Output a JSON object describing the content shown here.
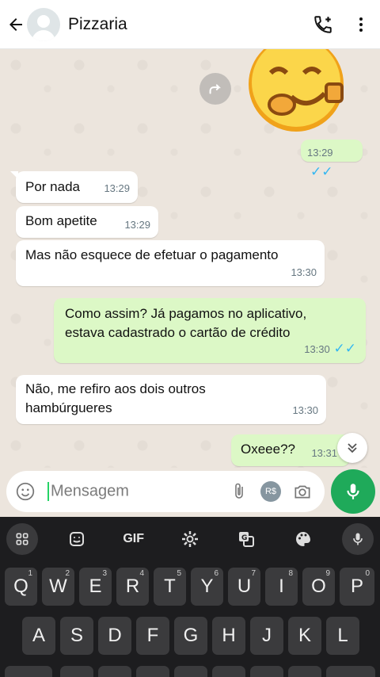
{
  "header": {
    "contact_name": "Pizzaria",
    "icons": [
      "back-arrow-icon",
      "avatar",
      "add-call-icon",
      "more-vert-icon"
    ]
  },
  "messages": [
    {
      "dir": "out",
      "type": "sticker",
      "time": "13:29",
      "status": "read"
    },
    {
      "dir": "in",
      "text": "Por nada",
      "time": "13:29"
    },
    {
      "dir": "in",
      "text": "Bom apetite",
      "time": "13:29"
    },
    {
      "dir": "in",
      "text": "Mas não esquece de efetuar o pagamento",
      "time": "13:30"
    },
    {
      "dir": "out",
      "text": "Como assim? Já pagamos no aplicativo,",
      "text2": "estava cadastrado o cartão de crédito",
      "time": "13:30",
      "status": "read"
    },
    {
      "dir": "in",
      "text": "Não, me refiro aos dois outros",
      "text2": "hambúrgueres",
      "time": "13:30"
    },
    {
      "dir": "out",
      "text": "Oxeee??",
      "time": "13:31",
      "status": "read"
    }
  ],
  "composer": {
    "placeholder": "Mensagem",
    "currency_badge": "R$"
  },
  "keyboard": {
    "toolbar": [
      "apps-grid-icon",
      "sticker-icon",
      "GIF",
      "settings-icon",
      "translate-icon",
      "palette-icon",
      "mic-icon"
    ],
    "row1": [
      {
        "k": "Q",
        "n": "1"
      },
      {
        "k": "W",
        "n": "2"
      },
      {
        "k": "E",
        "n": "3"
      },
      {
        "k": "R",
        "n": "4"
      },
      {
        "k": "T",
        "n": "5"
      },
      {
        "k": "Y",
        "n": "6"
      },
      {
        "k": "U",
        "n": "7"
      },
      {
        "k": "I",
        "n": "8"
      },
      {
        "k": "O",
        "n": "9"
      },
      {
        "k": "P",
        "n": "0"
      }
    ],
    "row2": [
      "A",
      "S",
      "D",
      "F",
      "G",
      "H",
      "J",
      "K",
      "L"
    ]
  },
  "colors": {
    "outgoing_bubble": "#dcf8c6",
    "incoming_bubble": "#ffffff",
    "read_ticks": "#34b7f1",
    "mic_fab": "#1faa5a",
    "keyboard_bg": "#1d1d1f"
  }
}
